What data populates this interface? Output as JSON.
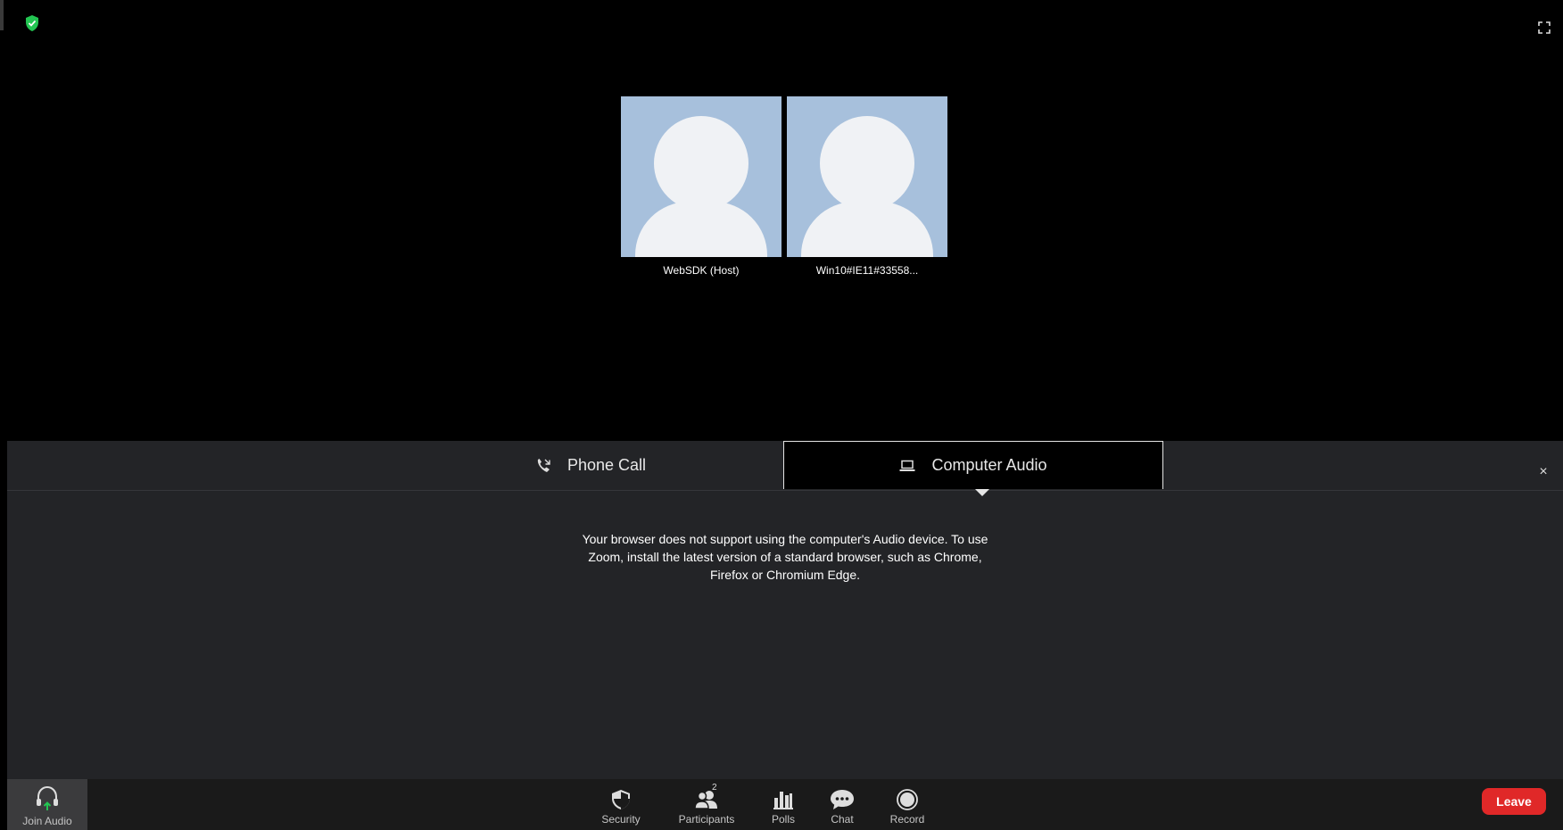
{
  "participants": [
    {
      "name": "WebSDK (Host)"
    },
    {
      "name": "Win10#IE11#33558..."
    }
  ],
  "audio_panel": {
    "tabs": [
      {
        "label": "Phone Call",
        "icon": "phone-icon",
        "selected": false
      },
      {
        "label": "Computer Audio",
        "icon": "laptop-icon",
        "selected": true
      }
    ],
    "close_label": "×",
    "message": "Your browser does not support using the computer's Audio device. To use Zoom, install the latest version of a standard browser, such as Chrome, Firefox or Chromium Edge."
  },
  "toolbar": {
    "join_audio": "Join Audio",
    "security": "Security",
    "participants": "Participants",
    "participants_count": "2",
    "polls": "Polls",
    "chat": "Chat",
    "record": "Record",
    "leave": "Leave"
  },
  "colors": {
    "background": "#000000",
    "panel": "#232427",
    "tile": "#a7c0dc",
    "leave": "#e02828",
    "shield": "#23c552",
    "join_arrow": "#23c552"
  }
}
